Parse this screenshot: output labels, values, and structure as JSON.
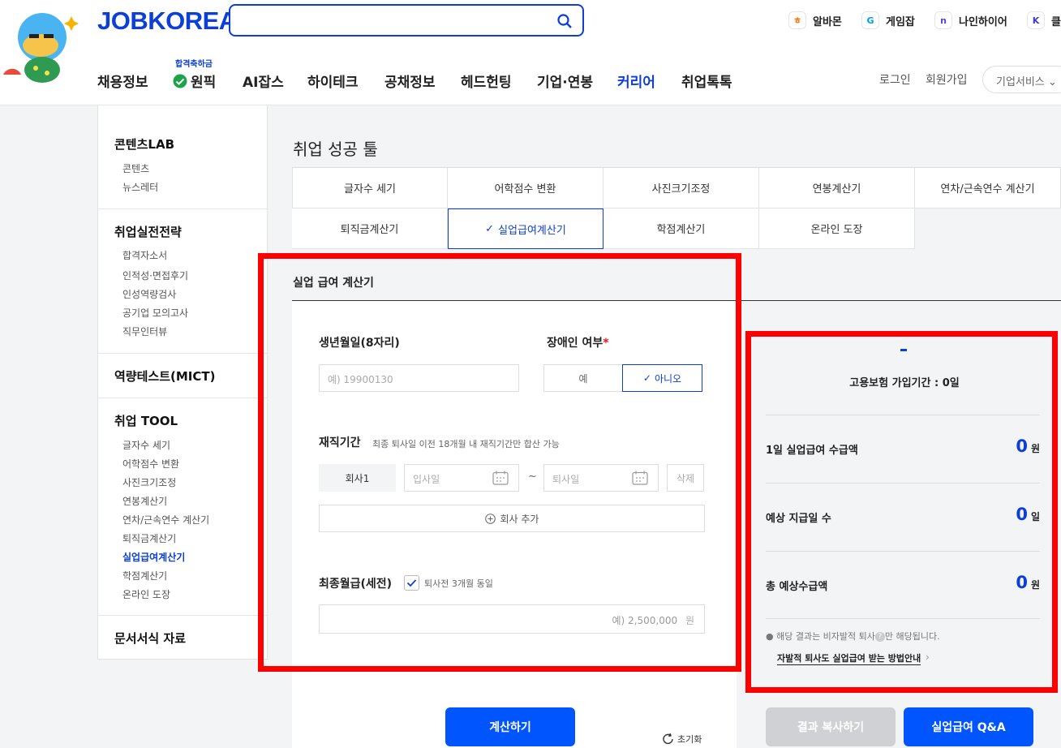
{
  "header": {
    "logo": "JOBKOREA",
    "family_sites": [
      {
        "label": "알바몬",
        "icon_text": "ㅎ",
        "color": "#ff6a00"
      },
      {
        "label": "게임잡",
        "icon_text": "G",
        "color": "#00a0e9"
      },
      {
        "label": "나인하이어",
        "icon_text": "n",
        "color": "#5b3cf0"
      },
      {
        "label": "클",
        "icon_text": "K",
        "color": "#3a3ad6"
      }
    ],
    "nav_badge": "합격축하금",
    "nav": [
      "채용정보",
      "원픽",
      "AI잡스",
      "하이테크",
      "공채정보",
      "헤드헌팅",
      "기업·연봉",
      "커리어",
      "취업톡톡"
    ],
    "login": "로그인",
    "signup": "회원가입",
    "biz": "기업서비스"
  },
  "sidebar": {
    "sections": [
      {
        "title": "콘텐츠LAB",
        "items": [
          "콘텐츠",
          "뉴스레터"
        ]
      },
      {
        "title": "취업실전전략",
        "items": [
          "합격자소서",
          "인적성·면접후기",
          "인성역량검사",
          "공기업 모의고사",
          "직무인터뷰"
        ]
      },
      {
        "title": "역량테스트(MICT)",
        "items": []
      },
      {
        "title": "취업 TOOL",
        "items": [
          "글자수 세기",
          "어학점수 변환",
          "사진크기조정",
          "연봉계산기",
          "연차/근속연수 계산기",
          "퇴직금계산기",
          "실업급여계산기",
          "학점계산기",
          "온라인 도장"
        ]
      },
      {
        "title": "문서서식 자료",
        "items": []
      }
    ]
  },
  "main": {
    "title": "취업 성공 툴",
    "tabs": [
      "글자수 세기",
      "어학점수 변환",
      "사진크기조정",
      "연봉계산기",
      "연차/근속연수 계산기",
      "퇴직금계산기",
      "실업급여계산기",
      "학점계산기",
      "온라인 도장"
    ],
    "active_tab": "실업급여계산기"
  },
  "calculator": {
    "heading": "실업 급여 계산기",
    "birth_label": "생년월일(8자리)",
    "birth_placeholder": "예) 19900130",
    "disability_label": "장애인 여부",
    "required_mark": "*",
    "yes": "예",
    "no": "아니오",
    "tenure_label": "재직기간",
    "tenure_note": "최종 퇴사일 이전 18개월 내 재직기간만 합산 가능",
    "company": "회사1",
    "join_placeholder": "입사일",
    "tilde": "~",
    "leave_placeholder": "퇴사일",
    "delete": "삭제",
    "add_company": "회사 추가",
    "salary_label": "최종월급(세전)",
    "salary_check": "퇴사전 3개월 동일",
    "salary_placeholder": "예) 2,500,000",
    "salary_unit": "원",
    "calc_button": "계산하기",
    "reset": "초기화"
  },
  "result": {
    "dash": "-",
    "period": "고용보험 가입기간 : 0일",
    "rows": [
      {
        "label": "1일 실업급여 수급액",
        "value": "0",
        "unit": "원"
      },
      {
        "label": "예상 지급일 수",
        "value": "0",
        "unit": "일"
      },
      {
        "label": "총 예상수급액",
        "value": "0",
        "unit": "원"
      }
    ],
    "note_before": "● 해당 결과는 비자발적 퇴사",
    "note_q": "?",
    "note_after": "만 해당됩니다.",
    "link": "자발적 퇴사도 실업급여 받는 방법안내",
    "link_arrow": "›",
    "copy_button": "결과 복사하기",
    "qa_button": "실업급여 Q&A"
  },
  "colors": {
    "brand": "#0b3fd6",
    "button": "#0055ff",
    "highlight": "#ff0000"
  }
}
